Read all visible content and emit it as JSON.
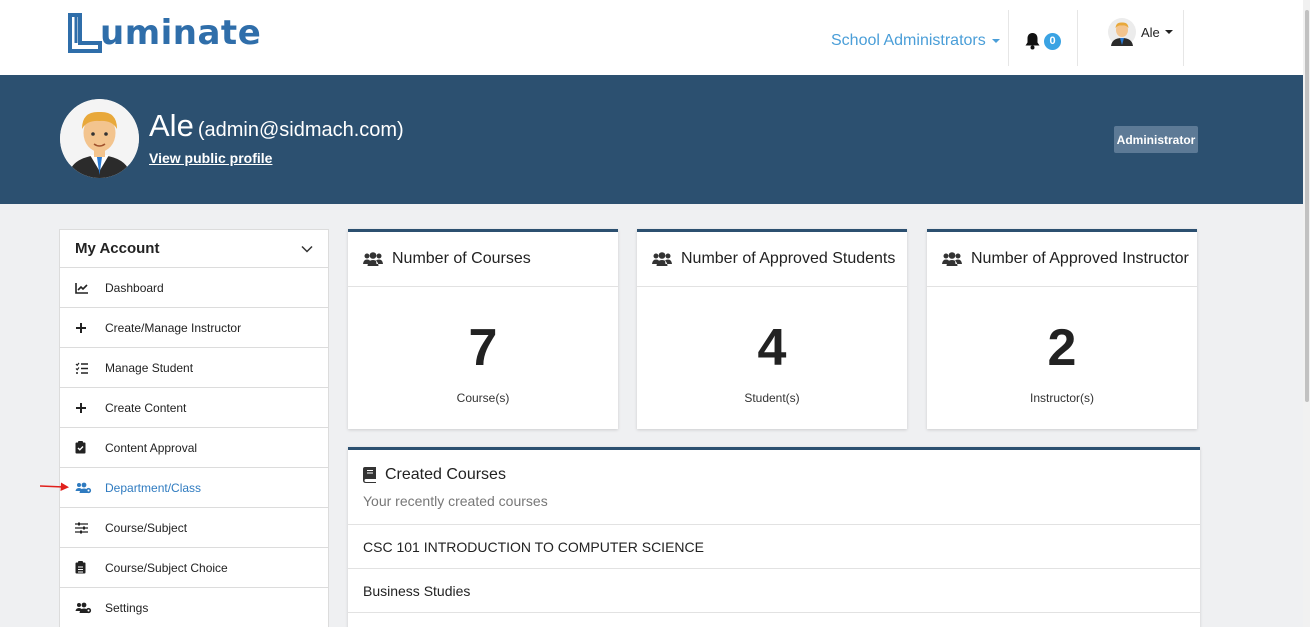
{
  "brand": {
    "logo_text": "uminate"
  },
  "topnav": {
    "role_menu": "School Administrators",
    "notifications_count": "0",
    "user_name": "Ale"
  },
  "profile": {
    "name": "Ale",
    "email": "(admin@sidmach.com)",
    "view_profile_link": "View public profile",
    "role_badge": "Administrator"
  },
  "sidebar": {
    "header": "My Account",
    "items": [
      {
        "label": "Dashboard",
        "icon": "chart-line-icon"
      },
      {
        "label": "Create/Manage Instructor",
        "icon": "plus-icon"
      },
      {
        "label": "Manage Student",
        "icon": "tasks-list-icon"
      },
      {
        "label": "Create Content",
        "icon": "plus-icon"
      },
      {
        "label": "Content Approval",
        "icon": "clipboard-check-icon"
      },
      {
        "label": "Department/Class",
        "icon": "users-cog-icon",
        "active": true
      },
      {
        "label": "Course/Subject",
        "icon": "sliders-icon"
      },
      {
        "label": "Course/Subject Choice",
        "icon": "clipboard-list-icon"
      },
      {
        "label": "Settings",
        "icon": "users-cog-icon"
      }
    ]
  },
  "stats": [
    {
      "title": "Number of Courses",
      "value": "7",
      "unit": "Course(s)"
    },
    {
      "title": "Number of Approved Students",
      "value": "4",
      "unit": "Student(s)"
    },
    {
      "title": "Number of Approved Instructor",
      "value": "2",
      "unit": "Instructor(s)"
    }
  ],
  "created_courses": {
    "title": "Created Courses",
    "subtitle": "Your recently created courses",
    "items": [
      "CSC 101 INTRODUCTION TO COMPUTER SCIENCE",
      "Business Studies"
    ]
  },
  "colors": {
    "banner": "#2c5070",
    "link_blue": "#4a9ed8",
    "active_item": "#2f7bc0",
    "badge": "#3aa3e3",
    "arrow": "#e0201c"
  }
}
